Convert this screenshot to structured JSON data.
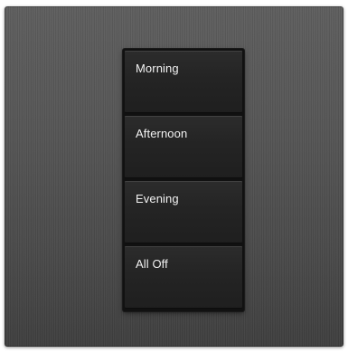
{
  "keypad": {
    "buttons": [
      {
        "label": "Morning"
      },
      {
        "label": "Afternoon"
      },
      {
        "label": "Evening"
      },
      {
        "label": "All Off"
      }
    ]
  },
  "colors": {
    "faceplate": "#535353",
    "button": "#242424",
    "label": "#f2f2f2"
  }
}
